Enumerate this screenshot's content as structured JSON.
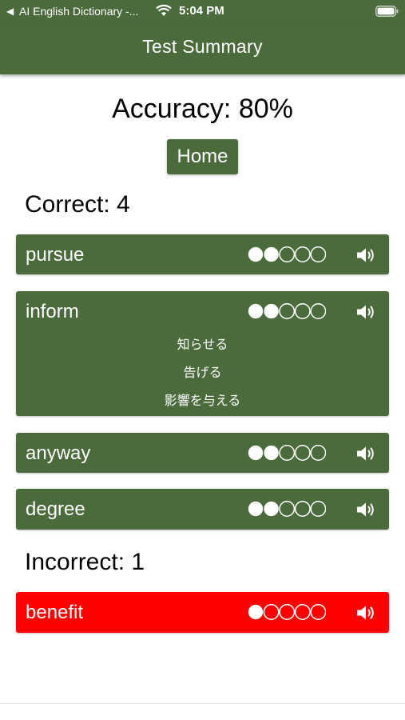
{
  "status_bar": {
    "back_indicator": "◀",
    "app_name": "AI English Dictionary -...",
    "time": "5:04 PM"
  },
  "nav": {
    "title": "Test Summary"
  },
  "summary": {
    "accuracy_text": "Accuracy: 80%",
    "home_label": "Home",
    "correct_heading": "Correct: 4",
    "incorrect_heading": "Incorrect: 1"
  },
  "correct_words": [
    {
      "word": "pursue",
      "level": 2,
      "max_level": 5,
      "meanings": []
    },
    {
      "word": "inform",
      "level": 2,
      "max_level": 5,
      "meanings": [
        "知らせる",
        "告げる",
        "影響を与える"
      ]
    },
    {
      "word": "anyway",
      "level": 2,
      "max_level": 5,
      "meanings": []
    },
    {
      "word": "degree",
      "level": 2,
      "max_level": 5,
      "meanings": []
    }
  ],
  "incorrect_words": [
    {
      "word": "benefit",
      "level": 1,
      "max_level": 5,
      "meanings": []
    }
  ],
  "colors": {
    "brand_green": "#4b6b3c",
    "incorrect_red": "#ff0000",
    "text_on_color": "#ffffff"
  },
  "icons": {
    "wifi": "wifi-icon",
    "battery": "battery-icon",
    "speaker": "speaker-icon"
  }
}
